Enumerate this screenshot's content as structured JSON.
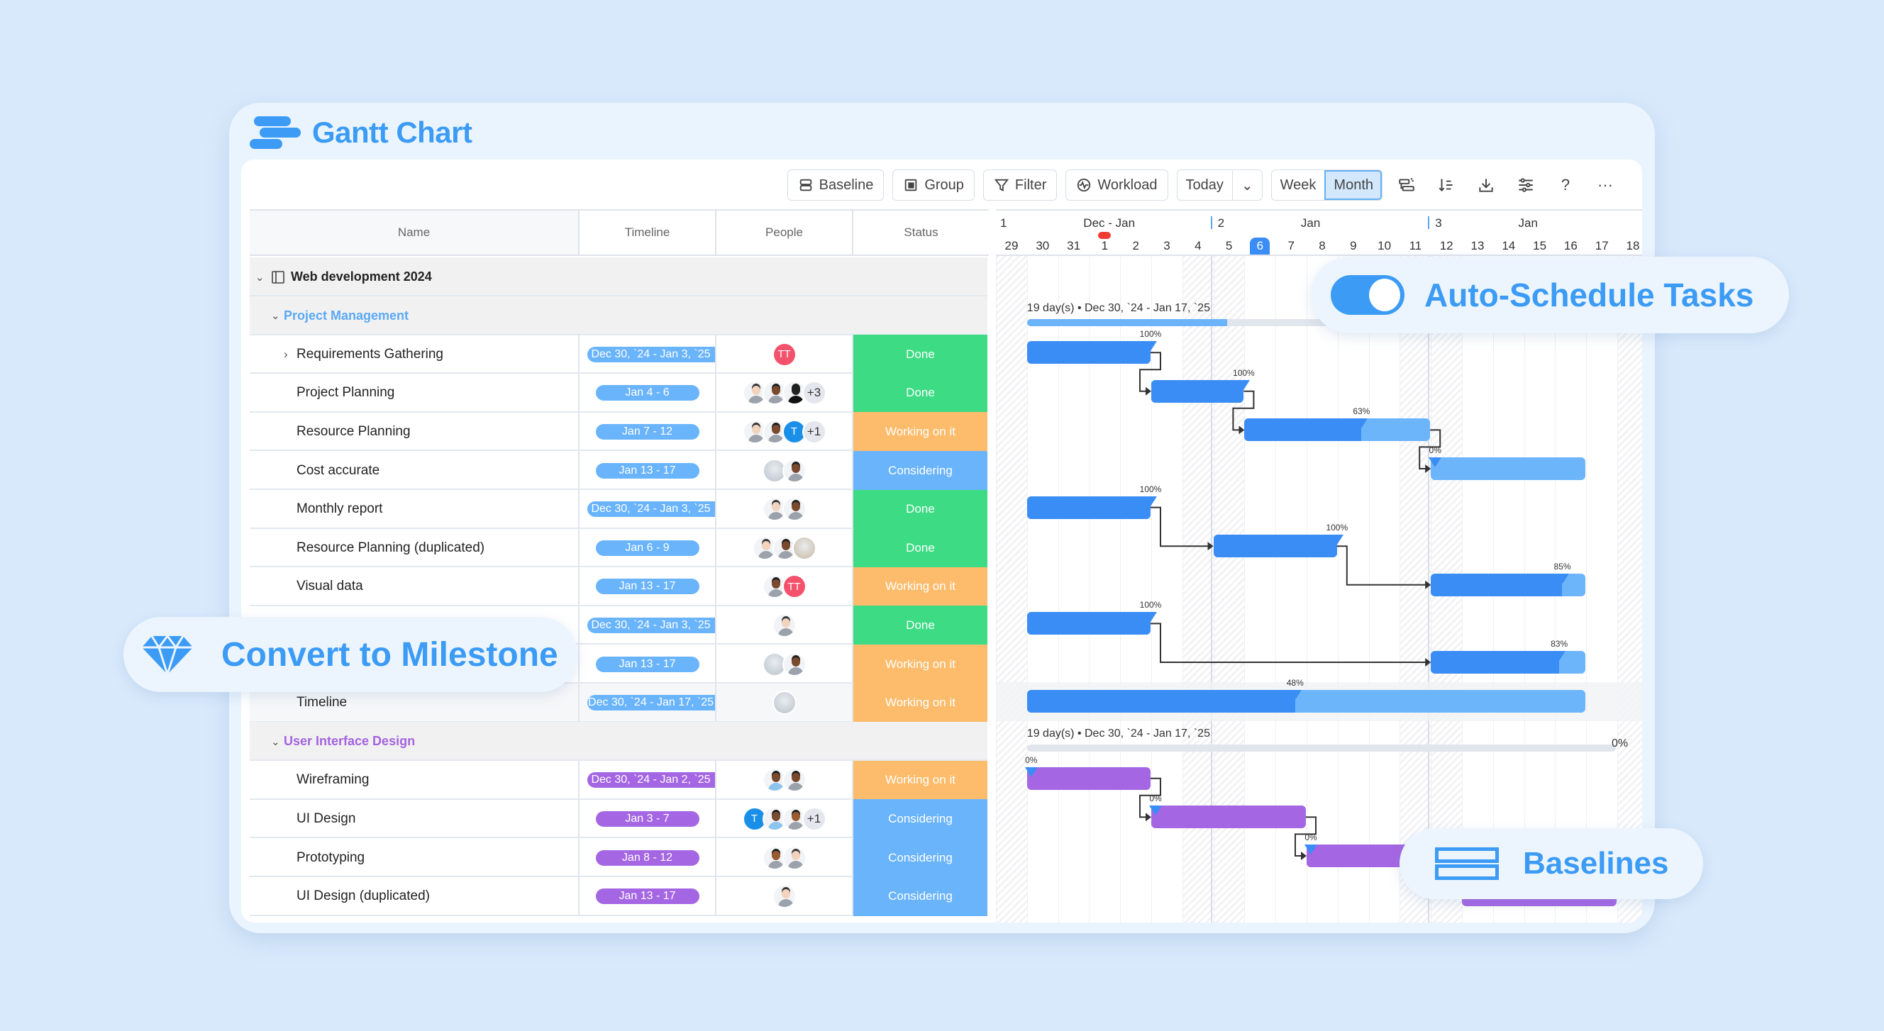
{
  "app": {
    "title": "Gantt Chart"
  },
  "toolbar": {
    "baseline": "Baseline",
    "group": "Group",
    "filter": "Filter",
    "workload": "Workload",
    "today": "Today",
    "week": "Week",
    "month": "Month",
    "icons": [
      "critical-path-icon",
      "sort-icon",
      "download-icon",
      "settings-sliders-icon",
      "help-icon",
      "more-icon"
    ],
    "help": "?",
    "more": "···"
  },
  "columns": {
    "name": "Name",
    "timeline": "Timeline",
    "people": "People",
    "status": "Status"
  },
  "timescale": {
    "weeks": [
      {
        "num": "1",
        "month": "Dec - Jan"
      },
      {
        "num": "2",
        "month": "Jan"
      },
      {
        "num": "3",
        "month": "Jan"
      }
    ],
    "days": [
      "29",
      "30",
      "31",
      "1",
      "2",
      "3",
      "4",
      "5",
      "6",
      "7",
      "8",
      "9",
      "10",
      "11",
      "12",
      "13",
      "14",
      "15",
      "16",
      "17",
      "18"
    ],
    "today": "6",
    "weekend_days": [
      "29",
      "4",
      "5",
      "11",
      "12",
      "18"
    ]
  },
  "colors": {
    "done": "#3ddc84",
    "working": "#fdbc6b",
    "considering": "#6ab4fc",
    "pm_accent": "#5aa9f5",
    "ui_accent": "#a463e0",
    "bar_blue": "#3b8df6",
    "bar_blue_light": "#6db5fb",
    "bar_purple": "#a566e3"
  },
  "project": {
    "name": "Web development 2024"
  },
  "groups": [
    {
      "name": "Project Management",
      "color": "pm",
      "summary": {
        "label": "19 day(s) • Dec 30, `24 - Jan 17, `25",
        "progress": 0.34
      },
      "tasks": [
        {
          "name": "Requirements Gathering",
          "expandable": true,
          "timeline": "Dec 30, `24 - Jan 3, `25",
          "people": [
            {
              "type": "initials",
              "text": "TT",
              "color": "#f4516c"
            }
          ],
          "status": "Done",
          "status_key": "done",
          "start": 1,
          "end": 5,
          "progress": 100
        },
        {
          "name": "Project Planning",
          "timeline": "Jan 4 - 6",
          "people": [
            {
              "type": "person"
            },
            {
              "type": "person",
              "skin": "#7a4a2f"
            },
            {
              "type": "person",
              "skin": "#222",
              "shirt": "#111"
            },
            {
              "type": "more",
              "text": "+3"
            }
          ],
          "status": "Done",
          "status_key": "done",
          "start": 5,
          "end": 8,
          "progress": 100
        },
        {
          "name": "Resource Planning",
          "timeline": "Jan 7 - 12",
          "people": [
            {
              "type": "person"
            },
            {
              "type": "person",
              "skin": "#7a4a2f"
            },
            {
              "type": "initials",
              "text": "T",
              "color": "#1a8fe8"
            },
            {
              "type": "more",
              "text": "+1"
            }
          ],
          "status": "Working on it",
          "status_key": "working",
          "start": 8,
          "end": 14,
          "progress": 63
        },
        {
          "name": "Cost accurate",
          "timeline": "Jan 13 - 17",
          "people": [
            {
              "type": "photo",
              "color": "#b9c3cc"
            },
            {
              "type": "person",
              "skin": "#7a4a2f"
            }
          ],
          "status": "Considering",
          "status_key": "considering",
          "start": 14,
          "end": 19,
          "progress": 0
        },
        {
          "name": "Monthly report",
          "timeline": "Dec 30, `24 - Jan 3, `25",
          "people": [
            {
              "type": "person"
            },
            {
              "type": "person",
              "skin": "#7a4a2f"
            }
          ],
          "status": "Done",
          "status_key": "done",
          "start": 1,
          "end": 5,
          "progress": 100
        },
        {
          "name": "Resource Planning (duplicated)",
          "timeline": "Jan 6 - 9",
          "people": [
            {
              "type": "person"
            },
            {
              "type": "person",
              "skin": "#7a4a2f"
            },
            {
              "type": "photo",
              "color": "#c8b8a0"
            }
          ],
          "status": "Done",
          "status_key": "done",
          "start": 7,
          "end": 11,
          "progress": 100
        },
        {
          "name": "Visual data",
          "timeline": "Jan 13 - 17",
          "people": [
            {
              "type": "person",
              "skin": "#7a4a2f"
            },
            {
              "type": "initials",
              "text": "TT",
              "color": "#f4516c"
            }
          ],
          "status": "Working on it",
          "status_key": "working",
          "start": 14,
          "end": 19,
          "progress": 85
        },
        {
          "name": "",
          "timeline": "Dec 30, `24 - Jan 3, `25",
          "people": [
            {
              "type": "person"
            }
          ],
          "status": "Done",
          "status_key": "done",
          "start": 1,
          "end": 5,
          "progress": 100
        },
        {
          "name": "",
          "timeline": "Jan 13 - 17",
          "people": [
            {
              "type": "photo",
              "color": "#b9c3cc"
            },
            {
              "type": "person",
              "skin": "#7a4a2f"
            }
          ],
          "status": "Working on it",
          "status_key": "working",
          "start": 14,
          "end": 19,
          "progress": 83
        },
        {
          "name": "Timeline",
          "timeline": "Dec 30, `24 - Jan 17, `25",
          "people": [
            {
              "type": "photo",
              "color": "#b9c3cc"
            }
          ],
          "status": "Working on it",
          "status_key": "working",
          "start": 1,
          "end": 19,
          "progress": 48,
          "highlight": true
        }
      ],
      "links": [
        [
          0,
          1
        ],
        [
          1,
          2
        ],
        [
          2,
          3
        ],
        [
          4,
          5
        ],
        [
          5,
          6
        ],
        [
          7,
          8
        ]
      ]
    },
    {
      "name": "User Interface Design",
      "color": "ui",
      "summary": {
        "label": "19 day(s) • Dec 30, `24 - Jan 17, `25",
        "progress": 0,
        "pct_label": "0%"
      },
      "tasks": [
        {
          "name": "Wireframing",
          "timeline": "Dec 30, `24 - Jan 2, `25",
          "people": [
            {
              "type": "person",
              "skin": "#7a4a2f",
              "shirt": "#8cc4ee"
            },
            {
              "type": "person",
              "skin": "#7a4a2f"
            }
          ],
          "status": "Working on it",
          "status_key": "working",
          "start": 1,
          "end": 5,
          "progress": 0
        },
        {
          "name": "UI Design",
          "timeline": "Jan 3 - 7",
          "people": [
            {
              "type": "initials",
              "text": "T",
              "color": "#1a8fe8"
            },
            {
              "type": "person",
              "skin": "#7a4a2f",
              "shirt": "#8cc4ee"
            },
            {
              "type": "person",
              "skin": "#9a5a32"
            },
            {
              "type": "more",
              "text": "+1"
            }
          ],
          "status": "Considering",
          "status_key": "considering",
          "start": 5,
          "end": 10,
          "progress": 0
        },
        {
          "name": "Prototyping",
          "timeline": "Jan 8 - 12",
          "people": [
            {
              "type": "person",
              "skin": "#9a5a32"
            },
            {
              "type": "person"
            }
          ],
          "status": "Considering",
          "status_key": "considering",
          "start": 10,
          "end": 15,
          "progress": 0
        },
        {
          "name": "UI Design (duplicated)",
          "timeline": "Jan 13 - 17",
          "people": [
            {
              "type": "person"
            }
          ],
          "status": "Considering",
          "status_key": "considering",
          "start": 15,
          "end": 20,
          "progress": 0
        }
      ],
      "links": [
        [
          0,
          1
        ],
        [
          1,
          2
        ],
        [
          2,
          3
        ]
      ]
    }
  ],
  "features": {
    "auto_schedule": "Auto-Schedule Tasks",
    "milestone": "Convert to Milestone",
    "baselines": "Baselines"
  }
}
